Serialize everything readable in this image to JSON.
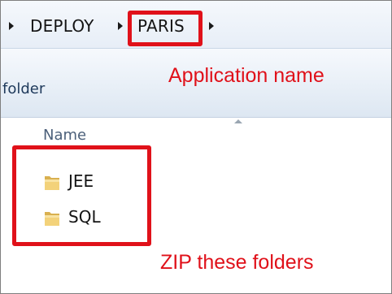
{
  "breadcrumb": {
    "items": [
      "DEPLOY",
      "PARIS"
    ]
  },
  "commandbar": {
    "partial_label": "folder"
  },
  "filelist": {
    "column_header": "Name",
    "rows": [
      {
        "name": "JEE",
        "icon": "folder-icon"
      },
      {
        "name": "SQL",
        "icon": "folder-icon"
      }
    ]
  },
  "annotations": {
    "app_name": "Application name",
    "zip_hint": "ZIP these folders",
    "color": "#e0111a"
  }
}
